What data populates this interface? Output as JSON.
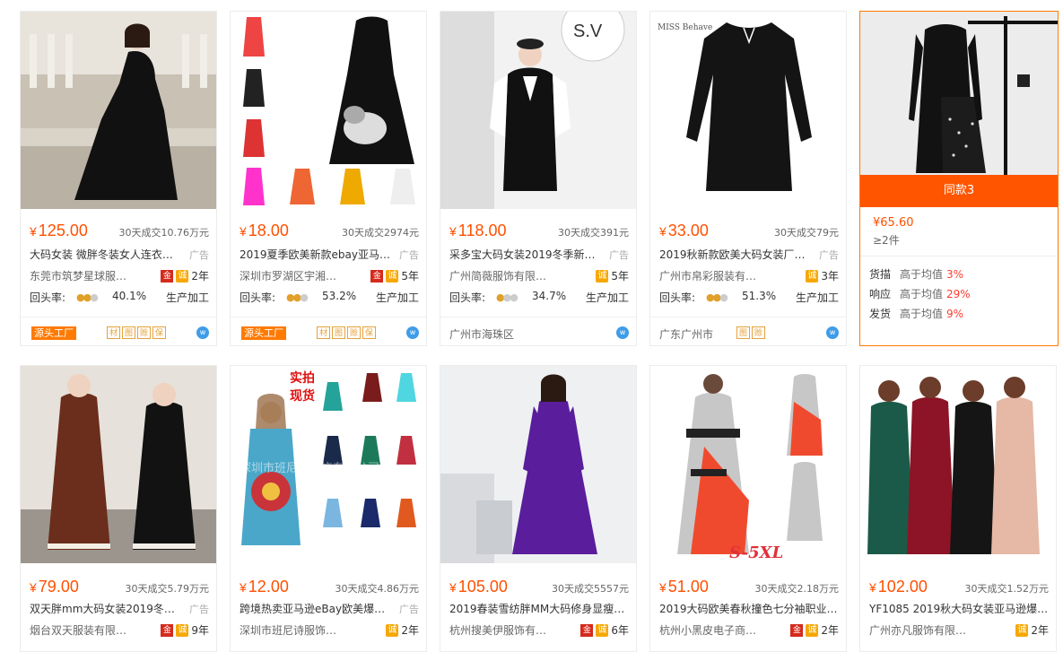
{
  "common": {
    "yen": "¥",
    "ad_label": "广告",
    "return_label": "回头率:",
    "factory_badge": "源头工厂",
    "cheng_icon": "诚",
    "gold_icon": "金",
    "wangwang_icon": "w"
  },
  "products": [
    {
      "price": "125.00",
      "sold": "30天成交10.76万元",
      "title": "大码女装 微胖冬装女人连衣…",
      "shop": "东莞市筑梦星球服…",
      "years": "2年",
      "gold": true,
      "return_rate": "40.1%",
      "mode": "生产加工",
      "footer_type": "factory",
      "mini_badges": [
        "材",
        "图",
        "赊",
        "保"
      ]
    },
    {
      "price": "18.00",
      "sold": "30天成交2974元",
      "title": "2019夏季欧美新款ebay亚马…",
      "shop": "深圳市罗湖区宇湘…",
      "years": "5年",
      "gold": true,
      "return_rate": "53.2%",
      "mode": "生产加工",
      "footer_type": "factory",
      "mini_badges": [
        "材",
        "图",
        "赊",
        "保"
      ]
    },
    {
      "price": "118.00",
      "sold": "30天成交391元",
      "title": "采多宝大码女装2019冬季新…",
      "shop": "广州简薇服饰有限…",
      "years": "5年",
      "gold": false,
      "return_rate": "34.7%",
      "mode": "生产加工",
      "footer_type": "location",
      "location": "广州市海珠区"
    },
    {
      "price": "33.00",
      "sold": "30天成交79元",
      "title": "2019秋新款欧美大码女装厂…",
      "shop": "广州市帛彩服装有…",
      "years": "3年",
      "gold": false,
      "return_rate": "51.3%",
      "mode": "生产加工",
      "footer_type": "location",
      "location": "广东广州市",
      "mini_badges": [
        "图",
        "赊"
      ]
    },
    {
      "price": "79.00",
      "sold": "30天成交5.79万元",
      "title": "双天胖mm大码女装2019冬…",
      "shop": "烟台双天服装有限…",
      "years": "9年",
      "gold": true
    },
    {
      "price": "12.00",
      "sold": "30天成交4.86万元",
      "title": "跨境热卖亚马逊eBay欧美爆…",
      "shop": "深圳市班尼诗服饰…",
      "years": "2年",
      "gold": false
    },
    {
      "price": "105.00",
      "sold": "30天成交5557元",
      "title": "2019春装雪纺胖MM大码修身显瘦长…",
      "shop": "杭州搜美伊服饰有…",
      "years": "6年",
      "gold": true
    },
    {
      "price": "51.00",
      "sold": "30天成交2.18万元",
      "title": "2019大码欧美春秋撞色七分袖职业…",
      "shop": "杭州小黑皮电子商…",
      "years": "2年",
      "gold": true
    },
    {
      "price": "102.00",
      "sold": "30天成交1.52万元",
      "title": "YF1085 2019秋大码女装亚马逊爆款…",
      "shop": "广州亦凡服饰有限…",
      "years": "2年",
      "gold": false
    }
  ],
  "popup": {
    "same_label": "同款3",
    "price": "¥65.60",
    "moq": "≥2件",
    "stats": [
      {
        "label": "货描",
        "compare": "高于均值",
        "pct": "3%"
      },
      {
        "label": "响应",
        "compare": "高于均值",
        "pct": "29%"
      },
      {
        "label": "发货",
        "compare": "高于均值",
        "pct": "9%"
      }
    ]
  },
  "image_texts": {
    "p3_sign": "S.V",
    "p4_brand": "MISS Behave",
    "p6_tag_1": "实拍",
    "p6_tag_2": "现货",
    "p6_watermark": "深圳市班尼诗服饰有限公司",
    "p8_size": "S-5XL"
  },
  "colors": {
    "accent": "#ff5000",
    "popup_bar": "#ff5500",
    "keyword": "#e4393c"
  }
}
